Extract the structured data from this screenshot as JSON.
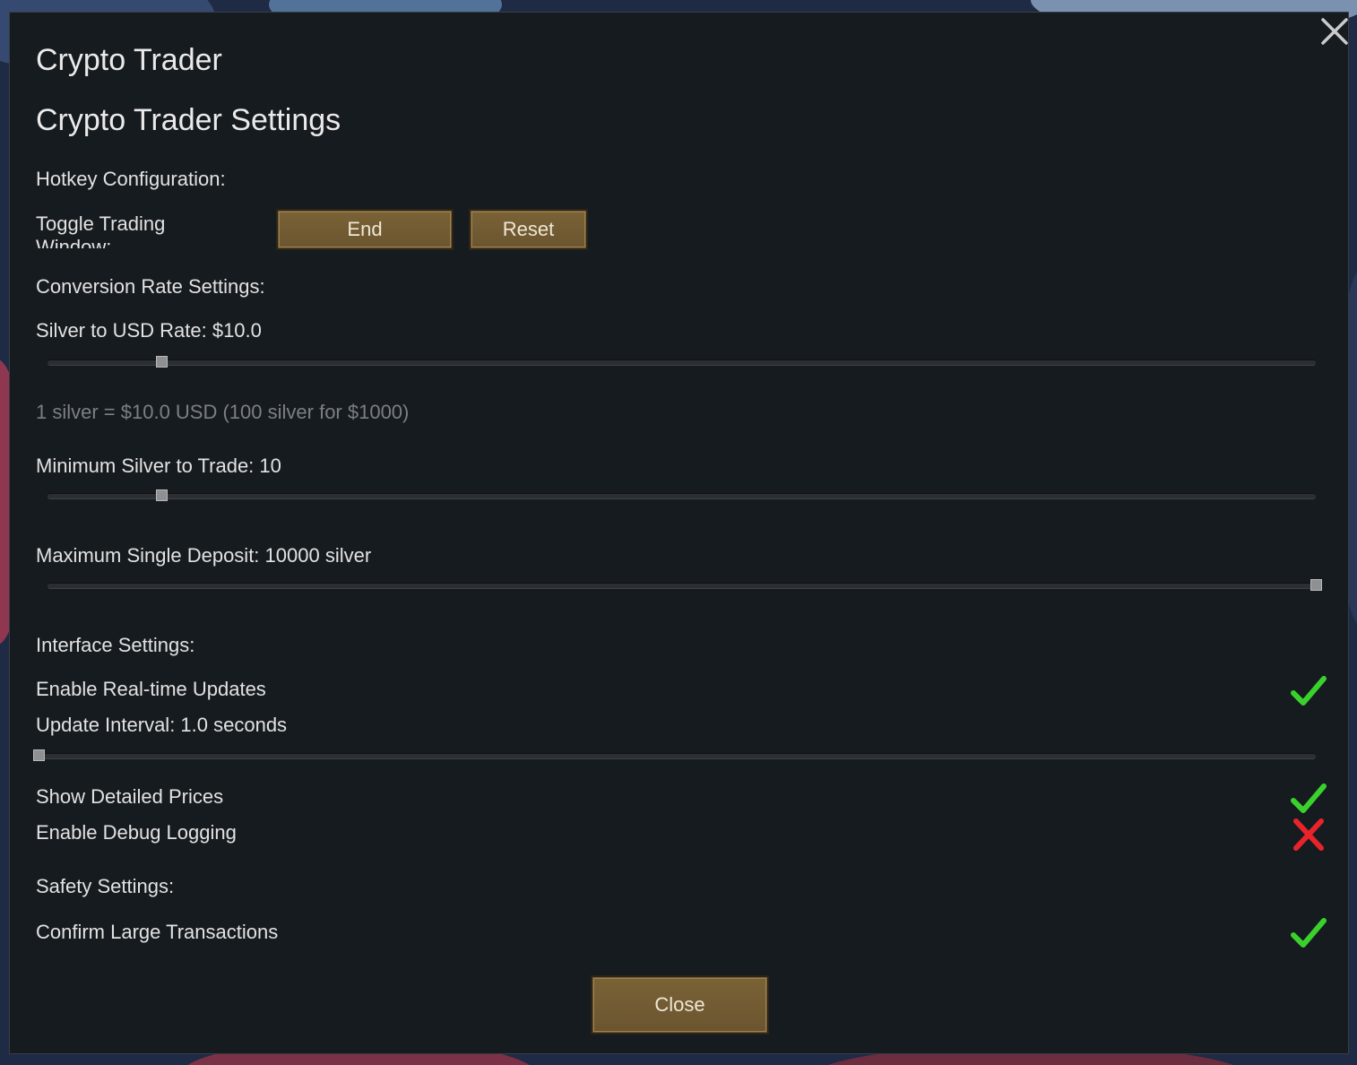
{
  "dialog": {
    "title": "Crypto Trader",
    "subtitle": "Crypto Trader Settings"
  },
  "hotkey": {
    "section_label": "Hotkey Configuration:",
    "toggle_label": "Toggle Trading Window:",
    "key_button": "End",
    "reset_button": "Reset"
  },
  "conversion": {
    "section_label": "Conversion Rate Settings:",
    "rate_label": "Silver to USD Rate: $10.0",
    "rate_slider_fraction": 0.09,
    "rate_hint": "1 silver = $10.0 USD (100 silver for $1000)",
    "min_label": "Minimum Silver to Trade: 10",
    "min_slider_fraction": 0.09,
    "max_label": "Maximum Single Deposit: 10000 silver",
    "max_slider_fraction": 1.0
  },
  "interface": {
    "section_label": "Interface Settings:",
    "realtime_label": "Enable Real-time Updates",
    "realtime_enabled": true,
    "interval_label": "Update Interval: 1.0 seconds",
    "interval_slider_fraction": 0.0,
    "detailed_label": "Show Detailed Prices",
    "detailed_enabled": true,
    "debug_label": "Enable Debug Logging",
    "debug_enabled": false
  },
  "safety": {
    "section_label": "Safety Settings:",
    "confirm_label": "Confirm Large Transactions",
    "confirm_enabled": true
  },
  "footer": {
    "close_button": "Close"
  },
  "icons": {
    "close": "close-x-icon",
    "enabled": "green-checkmark-icon",
    "disabled": "red-x-icon"
  },
  "colors": {
    "dialog_bg": "#161b20",
    "button_bg": "#6f5832",
    "check_green": "#3ad12c",
    "cross_red": "#e8242a"
  }
}
